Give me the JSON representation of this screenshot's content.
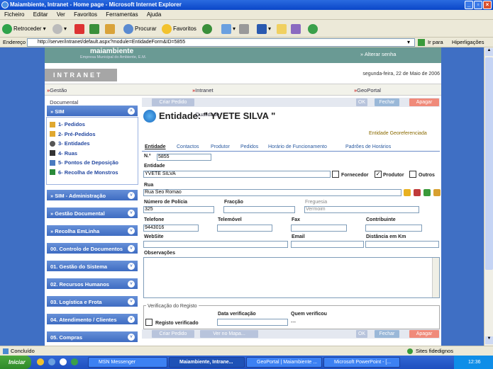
{
  "window": {
    "title": "Maiambiente, Intranet - Home page - Microsoft Internet Explorer"
  },
  "menubar": [
    "Ficheiro",
    "Editar",
    "Ver",
    "Favoritos",
    "Ferramentas",
    "Ajuda"
  ],
  "toolbar": {
    "back": "Retroceder",
    "search": "Procurar",
    "favorites": "Favoritos"
  },
  "address": {
    "label": "Endereço",
    "url": "http://server/intranet/default.aspx?module=EntidadeForm&ID=5855",
    "go": "Ir para",
    "links": "Hiperligações"
  },
  "site": {
    "logo": "maiambiente",
    "logo_sub": "Empresa Municipal do Ambiente, E.M.",
    "change_link": "» Alterar senha",
    "intranet": "INTRANET",
    "date": "segunda-feira, 22 de Maio de 2006"
  },
  "topnav": [
    "Gestão Documental",
    "Intranet da Qualidade",
    "GeoPortal"
  ],
  "leftmenu": {
    "sim": {
      "title": "» SIM",
      "items": [
        "1- Pedidos",
        "2- Pré-Pedidos",
        "3- Entidades",
        "4- Ruas",
        "5- Pontos de Deposição",
        "6- Recolha de Monstros"
      ]
    },
    "sections": [
      "» SIM - Administração",
      "» Gestão Documental",
      "» Recolha EmLinha",
      "00. Controlo de Documentos",
      "01. Gestão do Sistema",
      "02. Recursos Humanos",
      "03. Logística e Frota",
      "04. Atendimento / Clientes",
      "05. Compras"
    ]
  },
  "buttons": {
    "criar": "Criar Pedido",
    "ver_mapa": "Ver no Mapa...",
    "ok": "OK",
    "fechar": "Fechar",
    "apagar": "Apagar"
  },
  "entity": {
    "heading": "Entidade: \" YVETE SILVA \"",
    "georef": "Entidade Georeferenciada"
  },
  "tabs": [
    "Entidade",
    "Contactos",
    "Produtor",
    "Pedidos",
    "Horário de Funcionamento",
    "Padrões de Horários"
  ],
  "form": {
    "numero": {
      "label": "N.º",
      "value": "5855"
    },
    "entidade": {
      "label": "Entidade",
      "value": "YVETE SILVA"
    },
    "fornecedor": "Fornecedor",
    "produtor": "Produtor",
    "outros": "Outros",
    "rua": {
      "label": "Rua",
      "value": "Rua Seo Romao"
    },
    "policia": {
      "label": "Número de Polícia",
      "value": "325"
    },
    "fraccao": {
      "label": "Fracção",
      "value": ""
    },
    "freguesia": {
      "label": "Freguesia",
      "value": "Vermoim"
    },
    "telefone": {
      "label": "Telefone",
      "value": "9443016"
    },
    "telemovel": {
      "label": "Telemóvel",
      "value": ""
    },
    "fax": {
      "label": "Fax",
      "value": ""
    },
    "contribuinte": {
      "label": "Contribuinte",
      "value": ""
    },
    "website": {
      "label": "WebSite",
      "value": ""
    },
    "email": {
      "label": "Email",
      "value": ""
    },
    "distancia": {
      "label": "Distância em Km",
      "value": ""
    },
    "observacoes": {
      "label": "Observações",
      "value": ""
    },
    "verif_legend": "Verificação do Registo",
    "registo_verificado": "Registo verificado",
    "data_verif": "Data verificação",
    "quem_verif": "Quem verificou",
    "quem_verif_value": "---"
  },
  "status": {
    "text": "Concluído",
    "zone": "Sites fidedignos"
  },
  "taskbar": {
    "start": "Iniciar",
    "tasks": [
      "MSN Messenger",
      "Maiambiente, Intrane...",
      "GeoPortal | Maiambiente ...",
      "Microsoft PowerPoint - [..."
    ],
    "clock": "12:36"
  }
}
